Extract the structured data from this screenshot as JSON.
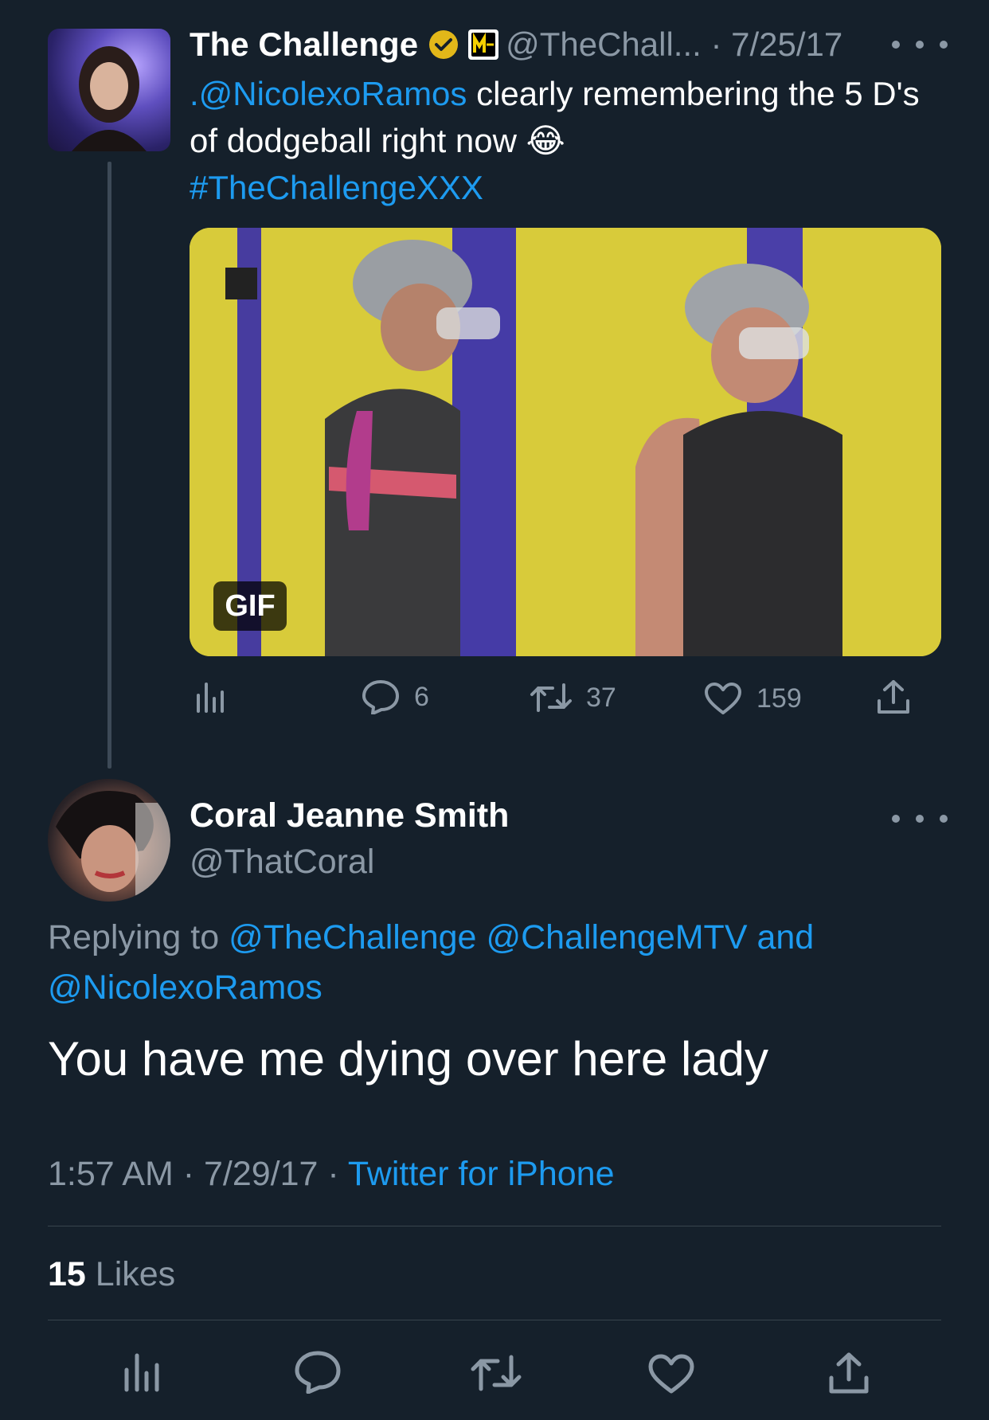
{
  "colors": {
    "background": "#15202b",
    "text": "#ffffff",
    "secondary": "#8b98a5",
    "link": "#1d9bf0",
    "divider": "#38444d",
    "verified_badge": "#e2b719"
  },
  "parent_tweet": {
    "display_name": "The Challenge",
    "handle_date": "@TheChall... · 7/25/17",
    "text_mention": ".@NicolexoRamos",
    "text_body": " clearly remembering the 5 D's of dodgeball right now ",
    "emoji": "😂",
    "hashtag": "#TheChallengeXXX",
    "media_badge": "GIF",
    "icons": {
      "verified": "verified-badge-icon",
      "affiliate": "mtv-logo-icon",
      "more": "more-dots-icon"
    },
    "actions": {
      "views": {
        "icon": "analytics-icon",
        "count": ""
      },
      "reply": {
        "icon": "reply-icon",
        "count": "6"
      },
      "retweet": {
        "icon": "retweet-icon",
        "count": "37"
      },
      "like": {
        "icon": "like-icon",
        "count": "159"
      },
      "share": {
        "icon": "share-icon",
        "count": ""
      }
    }
  },
  "reply_tweet": {
    "display_name": "Coral Jeanne Smith",
    "handle": "@ThatCoral",
    "replying_prefix": "Replying to ",
    "replying_mention_1": "@TheChallenge",
    "replying_mention_2": "@ChallengeMTV",
    "replying_and": "and",
    "replying_mention_3": "@NicolexoRamos",
    "text": "You have me dying over here lady",
    "time": "1:57 AM · 7/29/17 · ",
    "source": "Twitter for iPhone",
    "likes_count": "15",
    "likes_label": " Likes"
  }
}
